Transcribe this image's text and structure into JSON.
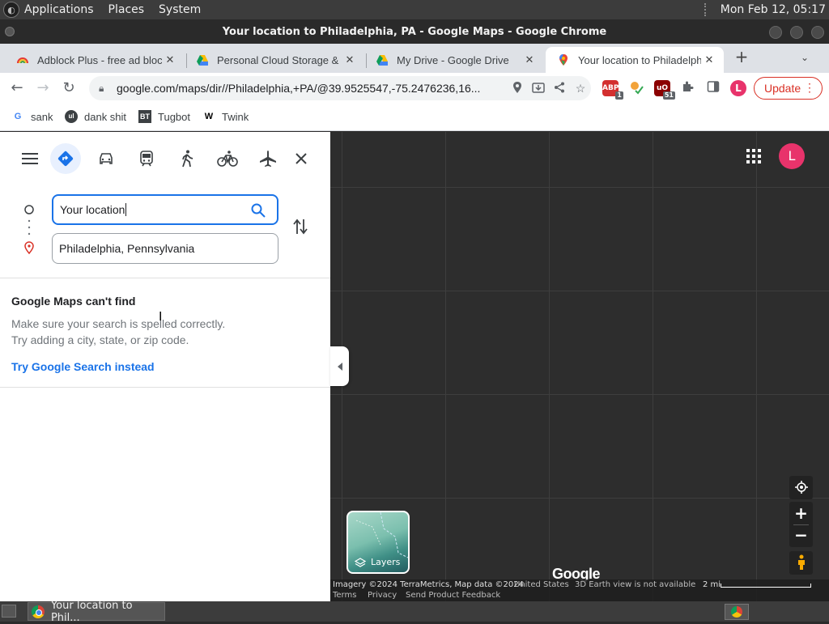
{
  "system_panel": {
    "menus": [
      "Applications",
      "Places",
      "System"
    ],
    "clock": "Mon Feb 12, 05:17"
  },
  "window": {
    "title": "Your location to Philadelphia, PA - Google Maps - Google Chrome"
  },
  "tabs": [
    {
      "label": "Adblock Plus - free ad bloc",
      "icon": "adblock-rainbow-icon",
      "active": false
    },
    {
      "label": "Personal Cloud Storage & F",
      "icon": "google-drive-icon",
      "active": false
    },
    {
      "label": "My Drive - Google Drive",
      "icon": "google-drive-icon",
      "active": false
    },
    {
      "label": "Your location to Philadelphi",
      "icon": "google-maps-icon",
      "active": true
    }
  ],
  "toolbar": {
    "url": "google.com/maps/dir//Philadelphia,+PA/@39.9525547,-75.2476236,16...",
    "update_label": "Update",
    "profile_initial": "L",
    "ext_badges": {
      "abp": "1",
      "ublock": "51"
    }
  },
  "bookmarks": [
    {
      "label": "sank",
      "icon": "google-icon"
    },
    {
      "label": "dank shit",
      "icon": "bookmark-circle-icon"
    },
    {
      "label": "Tugbot",
      "icon": "bt-icon"
    },
    {
      "label": "Twink",
      "icon": "w-icon"
    }
  ],
  "directions": {
    "origin_value": "Your location",
    "destination_value": "Philadelphia, Pennsylvania",
    "error_title": "Google Maps can't find",
    "error_line1": "Make sure your search is spelled correctly.",
    "error_line2": "Try adding a city, state, or zip code.",
    "try_search": "Try Google Search instead"
  },
  "map": {
    "avatar_initial": "L",
    "layers_label": "Layers",
    "watermark": "Google",
    "attribution": "Imagery ©2024 TerraMetrics, Map data ©2024",
    "region": "United States",
    "earth_note": "3D Earth view is not available",
    "scale": "2 mi",
    "links": [
      "Terms",
      "Privacy",
      "Send Product Feedback"
    ]
  },
  "taskbar": {
    "item_label": "Your location to Phil..."
  },
  "colors": {
    "accent_blue": "#1a73e8",
    "avatar_pink": "#e8336b",
    "update_red": "#d93025"
  }
}
